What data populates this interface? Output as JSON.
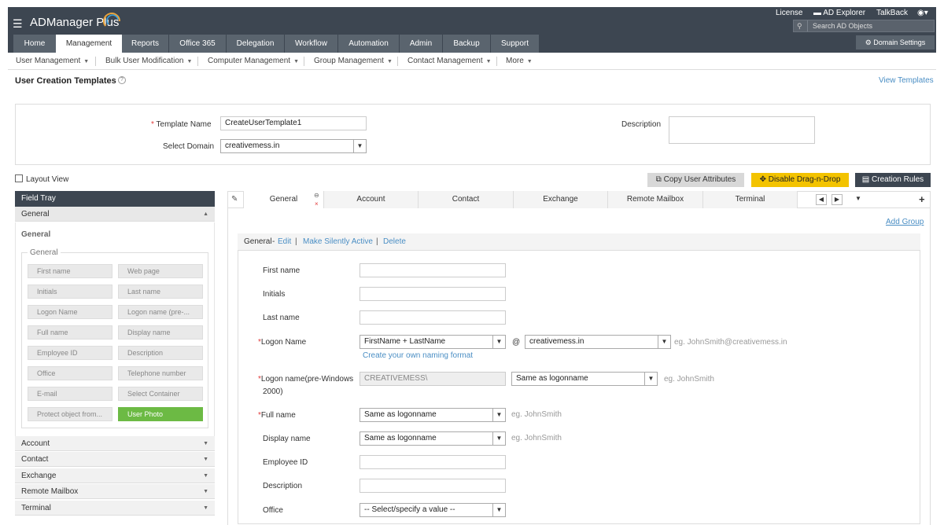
{
  "header": {
    "app_name": "ADManager Plus",
    "links": {
      "license": "License",
      "ad_explorer": "AD Explorer",
      "talkback": "TalkBack"
    },
    "search_placeholder": "Search AD Objects",
    "tabs": [
      "Home",
      "Management",
      "Reports",
      "Office 365",
      "Delegation",
      "Workflow",
      "Automation",
      "Admin",
      "Backup",
      "Support"
    ],
    "active_tab": "Management",
    "domain_settings": "Domain Settings"
  },
  "subnav": [
    "User Management",
    "Bulk User Modification",
    "Computer Management",
    "Group Management",
    "Contact Management",
    "More"
  ],
  "page": {
    "title": "User Creation Templates",
    "view_templates": "View Templates"
  },
  "form": {
    "template_name_label": "Template Name",
    "template_name_value": "CreateUserTemplate1",
    "select_domain_label": "Select Domain",
    "select_domain_value": "creativemess.in",
    "description_label": "Description",
    "description_value": ""
  },
  "toolbar": {
    "layout_view": "Layout View",
    "copy_attributes": "Copy User Attributes",
    "disable_dnd": "Disable Drag-n-Drop",
    "creation_rules": "Creation Rules"
  },
  "field_tray": {
    "title": "Field Tray",
    "general_section": "General",
    "general_heading": "General",
    "fieldset_label": "General",
    "fields": [
      "First name",
      "Web page",
      "Initials",
      "Last name",
      "Logon Name",
      "Logon name (pre-...",
      "Full name",
      "Display name",
      "Employee ID",
      "Description",
      "Office",
      "Telephone number",
      "E-mail",
      "Select Container",
      "Protect object from...",
      "User Photo"
    ],
    "sections": [
      "Account",
      "Contact",
      "Exchange",
      "Remote Mailbox",
      "Terminal"
    ]
  },
  "tabs": {
    "items": [
      "General",
      "Account",
      "Contact",
      "Exchange",
      "Remote Mailbox",
      "Terminal"
    ],
    "active": "General",
    "add_group": "Add Group"
  },
  "group": {
    "name": "General",
    "dash": "-",
    "edit": "Edit",
    "silent": "Make Silently Active",
    "delete": "Delete",
    "sep": "|"
  },
  "fields": {
    "first_name": "First name",
    "initials": "Initials",
    "last_name": "Last name",
    "logon_name": "Logon Name",
    "logon_format": "FirstName + LastName",
    "at": "@",
    "logon_domain": "creativemess.in",
    "logon_hint": "eg. JohnSmith@creativemess.in",
    "naming_link": "Create your own naming format",
    "pre2000_label_1": "Logon name(pre-Windows",
    "pre2000_label_2": "2000)",
    "pre2000_value": "CREATIVEMESS\\",
    "pre2000_select": "Same as logonname",
    "pre2000_hint": "eg. JohnSmith",
    "full_name": "Full name",
    "full_name_select": "Same as logonname",
    "full_name_hint": "eg. JohnSmith",
    "display_name": "Display name",
    "display_select": "Same as logonname",
    "display_hint": "eg. JohnSmith",
    "employee_id": "Employee ID",
    "description": "Description",
    "office": "Office",
    "office_select": "-- Select/specify a value --"
  },
  "required_mark": "*"
}
